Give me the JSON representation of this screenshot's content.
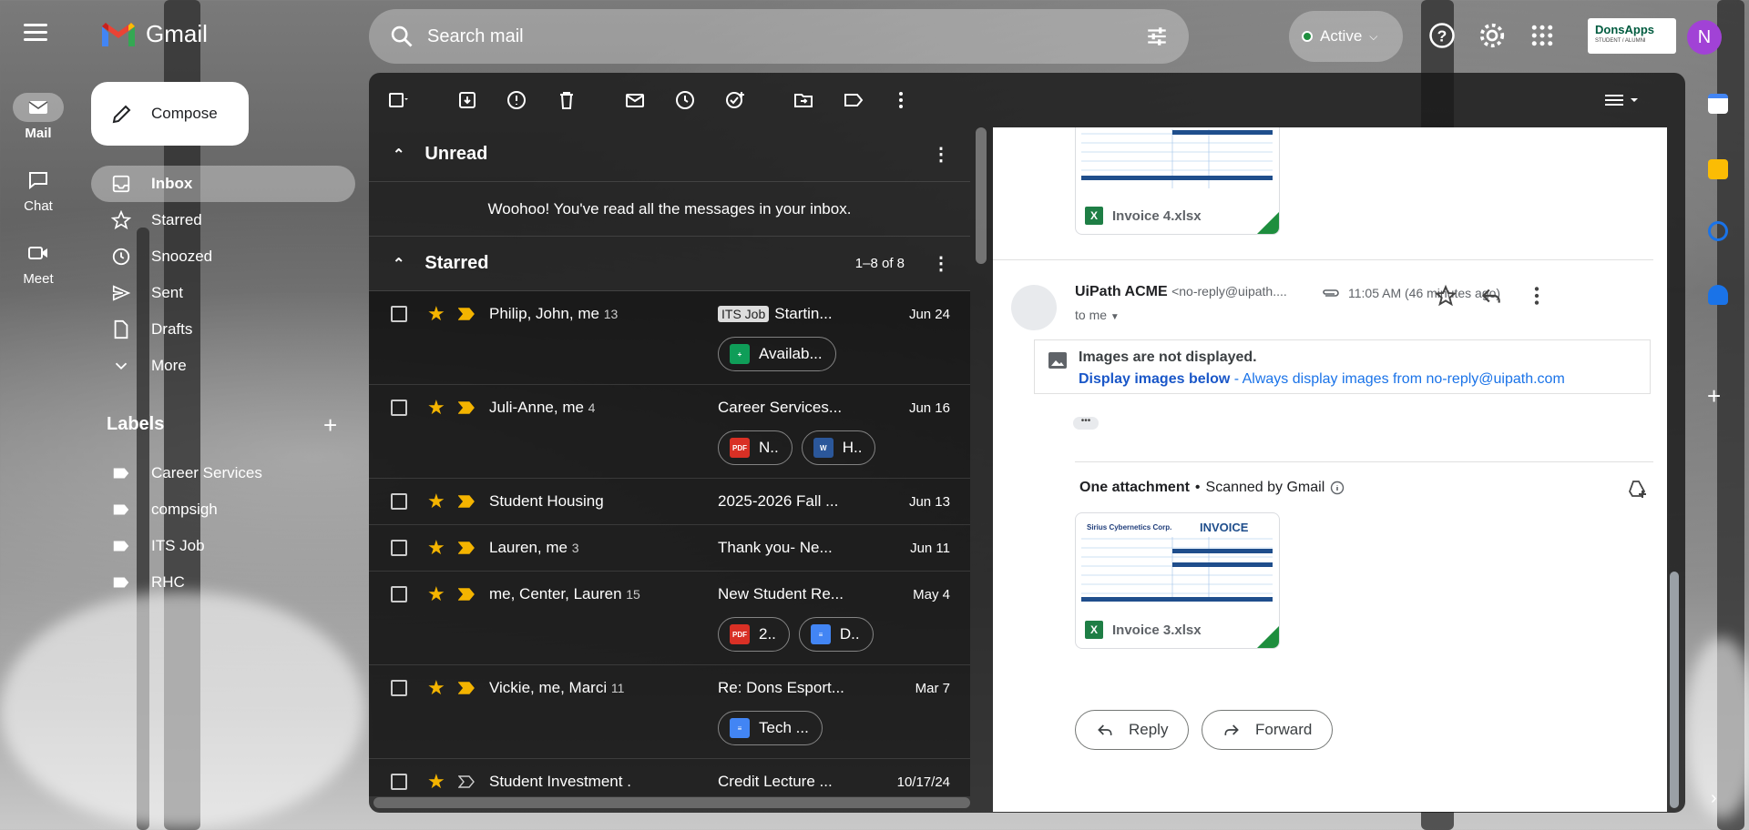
{
  "app": {
    "name": "Gmail",
    "avatar_letter": "N"
  },
  "search": {
    "placeholder": "Search mail"
  },
  "status": {
    "label": "Active"
  },
  "partner_logo": {
    "name": "DonsApps",
    "tagline": "STUDENT / ALUMNI"
  },
  "rail": [
    {
      "label": "Mail",
      "icon": "mail-icon"
    },
    {
      "label": "Chat",
      "icon": "chat-icon"
    },
    {
      "label": "Meet",
      "icon": "meet-icon"
    }
  ],
  "compose": {
    "label": "Compose"
  },
  "nav": [
    {
      "label": "Inbox",
      "icon": "inbox-icon",
      "active": true
    },
    {
      "label": "Starred",
      "icon": "star-icon"
    },
    {
      "label": "Snoozed",
      "icon": "clock-icon"
    },
    {
      "label": "Sent",
      "icon": "send-icon"
    },
    {
      "label": "Drafts",
      "icon": "draft-icon"
    },
    {
      "label": "More",
      "icon": "chevron-down-icon"
    }
  ],
  "labels": {
    "heading": "Labels",
    "items": [
      "Career Services",
      "compsigh",
      "ITS Job",
      "RHC"
    ]
  },
  "unread": {
    "title": "Unread",
    "empty_message": "Woohoo! You've read all the messages in your inbox."
  },
  "starred": {
    "title": "Starred",
    "range": "1–8 of 8",
    "rows": [
      {
        "sender": "Philip, John, me",
        "count": "13",
        "tag": "ITS Job",
        "subject": "Startin...",
        "date": "Jun 24",
        "chips": [
          {
            "type": "sheets",
            "label": "Availab..."
          }
        ]
      },
      {
        "sender": "Juli-Anne, me",
        "count": "4",
        "tag": "",
        "subject": "Career Services...",
        "date": "Jun 16",
        "chips": [
          {
            "type": "pdf",
            "label": "N.."
          },
          {
            "type": "word",
            "label": "H.."
          }
        ]
      },
      {
        "sender": "Student Housing",
        "count": "",
        "tag": "",
        "subject": "2025-2026 Fall ...",
        "date": "Jun 13",
        "chips": []
      },
      {
        "sender": "Lauren, me",
        "count": "3",
        "tag": "",
        "subject": "Thank you- Ne...",
        "date": "Jun 11",
        "chips": []
      },
      {
        "sender": "me, Center, Lauren",
        "count": "15",
        "tag": "",
        "subject": "New Student Re...",
        "date": "May 4",
        "chips": [
          {
            "type": "pdf",
            "label": "2.."
          },
          {
            "type": "docs",
            "label": "D.."
          }
        ]
      },
      {
        "sender": "Vickie, me, Marci",
        "count": "11",
        "tag": "",
        "subject": "Re: Dons Esport...",
        "date": "Mar 7",
        "chips": [
          {
            "type": "docs",
            "label": "Tech ..."
          }
        ]
      },
      {
        "sender": "Student Investment .",
        "count": "",
        "tag": "",
        "subject": "Credit Lecture ...",
        "date": "10/17/24",
        "chips": []
      }
    ]
  },
  "reader": {
    "top_attachment": "Invoice 4.xlsx",
    "from_name": "UiPath ACME",
    "from_addr": "<no-reply@uipath....",
    "time": "11:05 AM (46 minutes ago)",
    "to": "to me",
    "images_notice": "Images are not displayed.",
    "display_link": "Display images below",
    "always_link": " - Always display images from no-reply@uipath.com",
    "attach_title": "One attachment",
    "attach_scan": "Scanned by Gmail",
    "attachment": "Invoice 3.xlsx",
    "sheet_company": "Sirius Cybernetics Corp.",
    "sheet_title": "INVOICE",
    "reply_label": "Reply",
    "forward_label": "Forward"
  },
  "colors": {
    "accent_star": "#f4b400",
    "status_green": "#1e8e3e",
    "avatar": "#a142d6",
    "link": "#1a73e8"
  }
}
